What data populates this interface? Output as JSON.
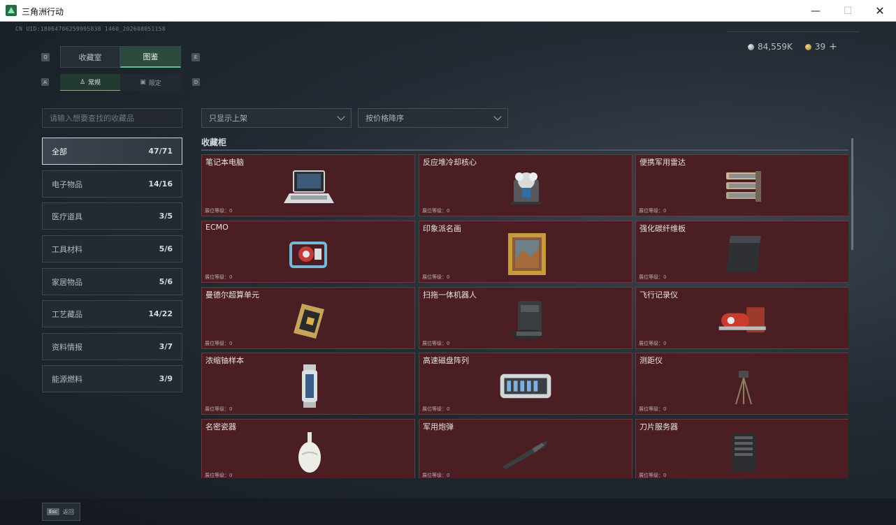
{
  "window": {
    "title": "三角洲行动",
    "min": "—",
    "max": "☐",
    "close": "✕"
  },
  "uid": "CN UID:18064706259995838 1460_202608051158",
  "currency": {
    "silver": "84,559K",
    "gold": "39",
    "plus": "+"
  },
  "tabs": {
    "left_key": "Q",
    "right_key": "E",
    "items": [
      {
        "label": "收藏室"
      },
      {
        "label": "图鉴"
      }
    ]
  },
  "subtabs": {
    "left_key": "A",
    "right_key": "D",
    "items": [
      {
        "label": "常规"
      },
      {
        "label": "限定"
      }
    ]
  },
  "search": {
    "placeholder": "请输入想要查找的收藏品"
  },
  "filters": {
    "shelf": "只显示上架",
    "sort": "按价格降序"
  },
  "categories": [
    {
      "label": "全部",
      "count": "47/71"
    },
    {
      "label": "电子物品",
      "count": "14/16"
    },
    {
      "label": "医疗道具",
      "count": "3/5"
    },
    {
      "label": "工具材料",
      "count": "5/6"
    },
    {
      "label": "家居物品",
      "count": "5/6"
    },
    {
      "label": "工艺藏品",
      "count": "14/22"
    },
    {
      "label": "资料情报",
      "count": "3/7"
    },
    {
      "label": "能源燃料",
      "count": "3/9"
    }
  ],
  "section_title": "收藏柜",
  "items": [
    {
      "name": "笔记本电脑",
      "level": "展位等级：0",
      "icon": "laptop-icon"
    },
    {
      "name": "反应堆冷却核心",
      "level": "展位等级：0",
      "icon": "reactor-core-icon"
    },
    {
      "name": "便携军用雷达",
      "level": "展位等级：0",
      "icon": "radar-icon"
    },
    {
      "name": "ECMO",
      "level": "展位等级：0",
      "icon": "ecmo-icon"
    },
    {
      "name": "印象派名画",
      "level": "展位等级：0",
      "icon": "painting-icon"
    },
    {
      "name": "强化碳纤维板",
      "level": "展位等级：0",
      "icon": "carbon-plate-icon"
    },
    {
      "name": "曼德尔超算单元",
      "level": "展位等级：0",
      "icon": "supercomputer-chip-icon"
    },
    {
      "name": "扫拖一体机器人",
      "level": "展位等级：0",
      "icon": "robot-vacuum-icon"
    },
    {
      "name": "飞行记录仪",
      "level": "展位等级：0",
      "icon": "flight-recorder-icon"
    },
    {
      "name": "浓缩铀样本",
      "level": "展位等级：0",
      "icon": "uranium-sample-icon"
    },
    {
      "name": "高速磁盘阵列",
      "level": "展位等级：0",
      "icon": "disk-array-icon"
    },
    {
      "name": "测距仪",
      "level": "展位等级：0",
      "icon": "rangefinder-icon"
    },
    {
      "name": "名密瓷器",
      "level": "展位等级：0",
      "icon": "porcelain-vase-icon"
    },
    {
      "name": "军用炮弹",
      "level": "展位等级：0",
      "icon": "artillery-shell-icon"
    },
    {
      "name": "刀片服务器",
      "level": "展位等级：0",
      "icon": "blade-server-icon"
    }
  ],
  "footer": {
    "key": "Esc",
    "label": "返回"
  },
  "colors": {
    "accent": "#58c890",
    "card_bg": "#4a1e22"
  }
}
